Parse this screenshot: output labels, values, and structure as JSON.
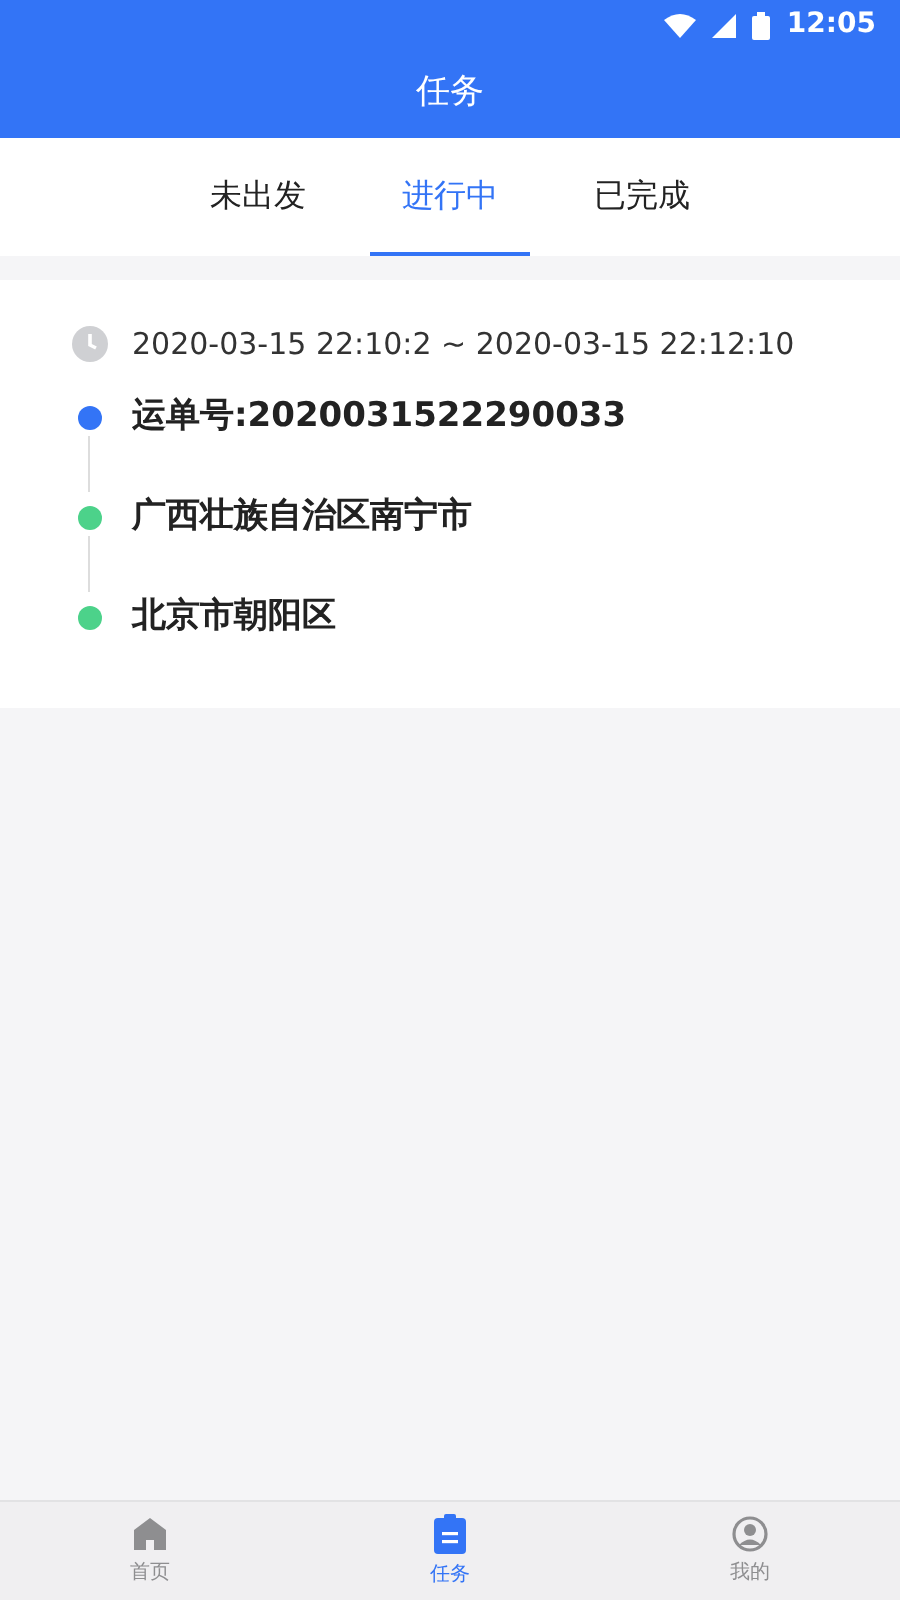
{
  "status_bar": {
    "time": "12:05"
  },
  "header": {
    "title": "任务"
  },
  "tabs": [
    {
      "label": "未出发",
      "selected": false
    },
    {
      "label": "进行中",
      "selected": true
    },
    {
      "label": "已完成",
      "selected": false
    }
  ],
  "task": {
    "time_range": "2020-03-15 22:10:2 ~ 2020-03-15 22:12:10",
    "steps": [
      {
        "text": "运单号:2020031522290033",
        "color": "#3374f6"
      },
      {
        "text": "广西壮族自治区南宁市",
        "color": "#4cd28a"
      },
      {
        "text": "北京市朝阳区",
        "color": "#4cd28a"
      }
    ]
  },
  "bottom_nav": [
    {
      "kind": "home",
      "label": "首页",
      "selected": false
    },
    {
      "kind": "task",
      "label": "任务",
      "selected": true
    },
    {
      "kind": "profile",
      "label": "我的",
      "selected": false
    }
  ]
}
